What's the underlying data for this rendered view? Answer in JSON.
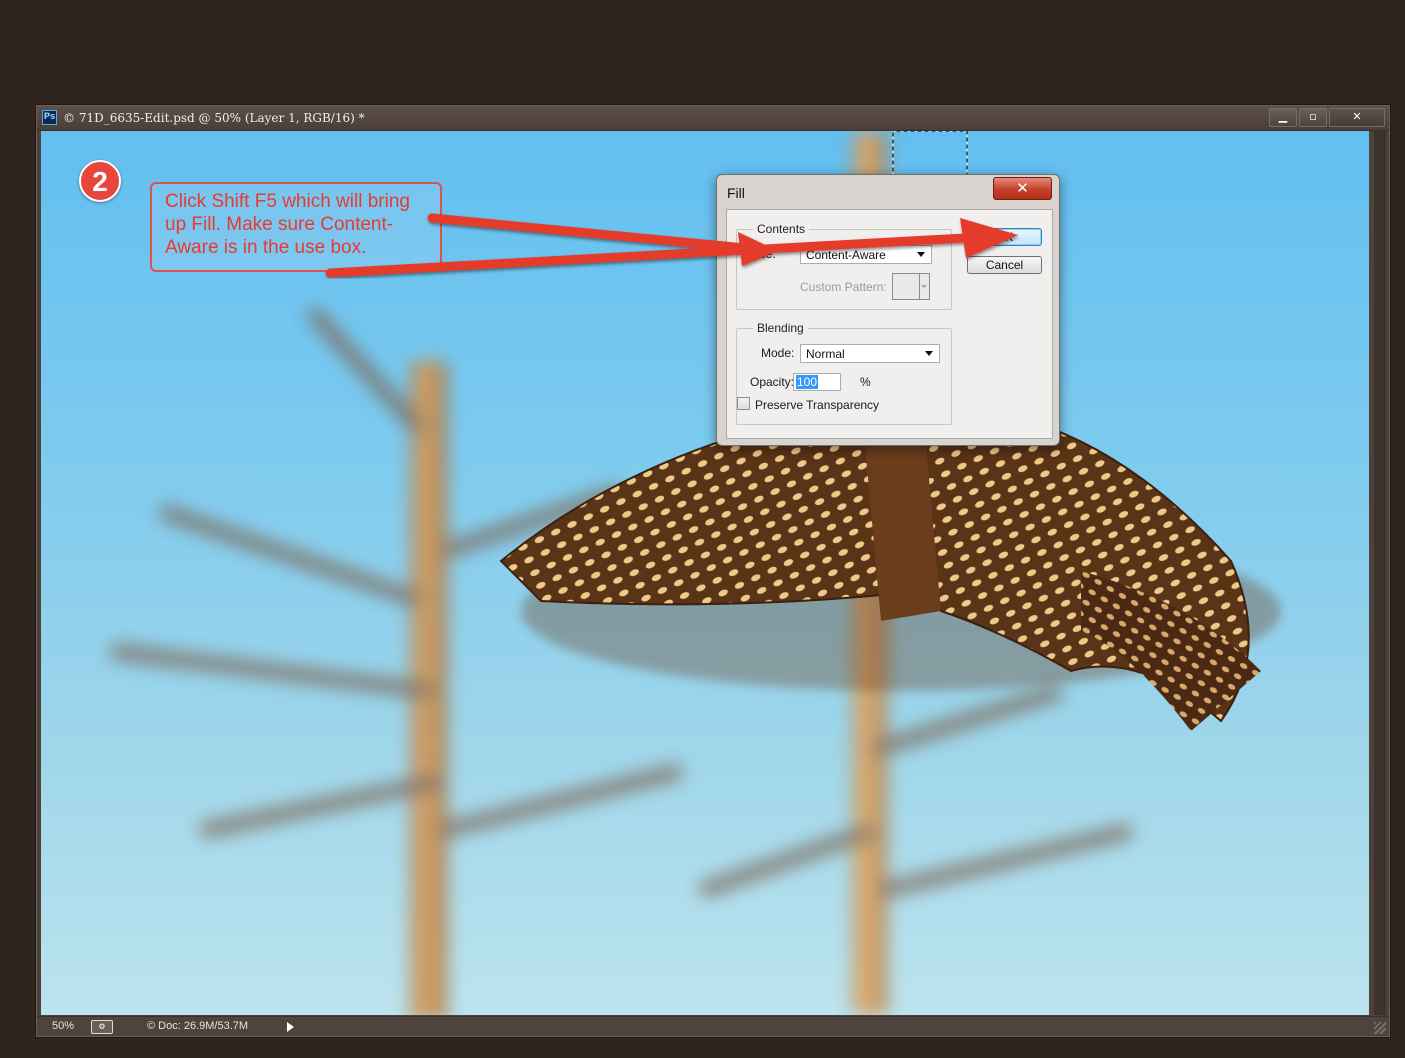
{
  "window": {
    "title": "© 71D_6635-Edit.psd @ 50% (Layer 1, RGB/16) *",
    "app_icon": "Ps",
    "controls": {
      "minimize": "▁",
      "maximize": "▫",
      "close": "✕"
    }
  },
  "statusbar": {
    "zoom": "50%",
    "doc_info": "© Doc: 26.9M/53.7M"
  },
  "annotation": {
    "step_number": "2",
    "callout_text": "Click Shift F5 which will bring up Fill. Make sure Content-Aware is in the use box.",
    "accent_color": "#e8453c"
  },
  "fill_dialog": {
    "title": "Fill",
    "close": "✕",
    "contents": {
      "legend": "Contents",
      "use_label": "Use:",
      "use_value": "Content-Aware",
      "custom_pattern_label": "Custom Pattern:"
    },
    "blending": {
      "legend": "Blending",
      "mode_label": "Mode:",
      "mode_value": "Normal",
      "opacity_label": "Opacity:",
      "opacity_value": "100",
      "opacity_unit": "%",
      "preserve_label": "Preserve Transparency"
    },
    "ok_label": "OK",
    "cancel_label": "Cancel"
  },
  "icons": [
    "photoshop-icon",
    "minimize-icon",
    "maximize-icon",
    "close-icon",
    "dropdown-caret-icon",
    "status-arrow-icon"
  ]
}
